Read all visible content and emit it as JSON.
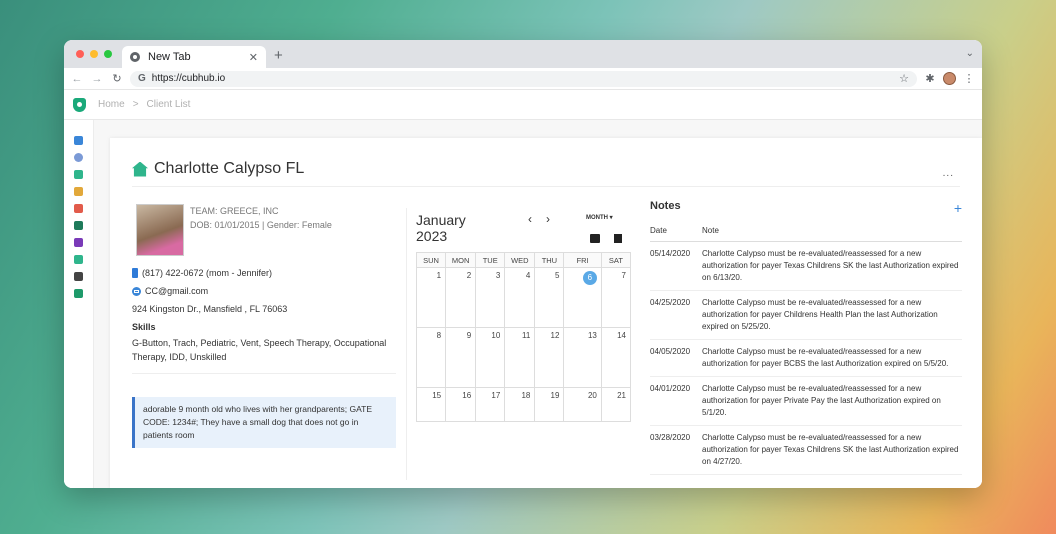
{
  "browser": {
    "tab_title": "New Tab",
    "url": "https://cubhub.io"
  },
  "breadcrumb": {
    "home": "Home",
    "sep": ">",
    "current": "Client List"
  },
  "client": {
    "name": "Charlotte Calypso FL",
    "team": "TEAM: GREECE, INC",
    "dob_gender": "DOB: 01/01/2015 | Gender: Female",
    "phone": "(817) 422-0672 (mom - Jennifer)",
    "email": "CC@gmail.com",
    "address": "924 Kingston Dr., Mansfield , FL 76063",
    "skills_title": "Skills",
    "skills": "G-Button, Trach, Pediatric, Vent, Speech Therapy, Occupational Therapy, IDD, Unskilled",
    "note": "adorable 9 month old who lives with her grandparents; GATE CODE: 1234#; They have a small dog that does not go in patients room"
  },
  "calendar": {
    "month": "January",
    "year": "2023",
    "view": "MONTH ▾",
    "days": [
      "SUN",
      "MON",
      "TUE",
      "WED",
      "THU",
      "FRI",
      "SAT"
    ],
    "weeks": [
      [
        "1",
        "2",
        "3",
        "4",
        "5",
        "6",
        "7"
      ],
      [
        "8",
        "9",
        "10",
        "11",
        "12",
        "13",
        "14"
      ],
      [
        "15",
        "16",
        "17",
        "18",
        "19",
        "20",
        "21"
      ]
    ],
    "today": "6"
  },
  "notes": {
    "title": "Notes",
    "col_date": "Date",
    "col_note": "Note",
    "rows": [
      {
        "date": "05/14/2020",
        "text": "Charlotte Calypso must be re-evaluated/reassessed for a new authorization for payer Texas Childrens SK the last Authorization expired on 6/13/20."
      },
      {
        "date": "04/25/2020",
        "text": "Charlotte Calypso must be re-evaluated/reassessed for a new authorization for payer Childrens Health Plan the last Authorization expired on 5/25/20."
      },
      {
        "date": "04/05/2020",
        "text": "Charlotte Calypso must be re-evaluated/reassessed for a new authorization for payer BCBS the last Authorization expired on 5/5/20."
      },
      {
        "date": "04/01/2020",
        "text": "Charlotte Calypso must be re-evaluated/reassessed for a new authorization for payer Private Pay the last Authorization expired on 5/1/20."
      },
      {
        "date": "03/28/2020",
        "text": "Charlotte Calypso must be re-evaluated/reassessed for a new authorization for payer Texas Childrens SK the last Authorization expired on 4/27/20."
      }
    ]
  },
  "colors": {
    "brand": "#1aa97a",
    "accent": "#3a86d8",
    "today": "#5aa9e6"
  },
  "sidebar_icons": [
    "home-icon",
    "check-icon",
    "house-icon",
    "people-icon",
    "calendar-icon",
    "document-icon",
    "hand-icon",
    "folder-icon",
    "billing-icon",
    "tools-icon"
  ]
}
